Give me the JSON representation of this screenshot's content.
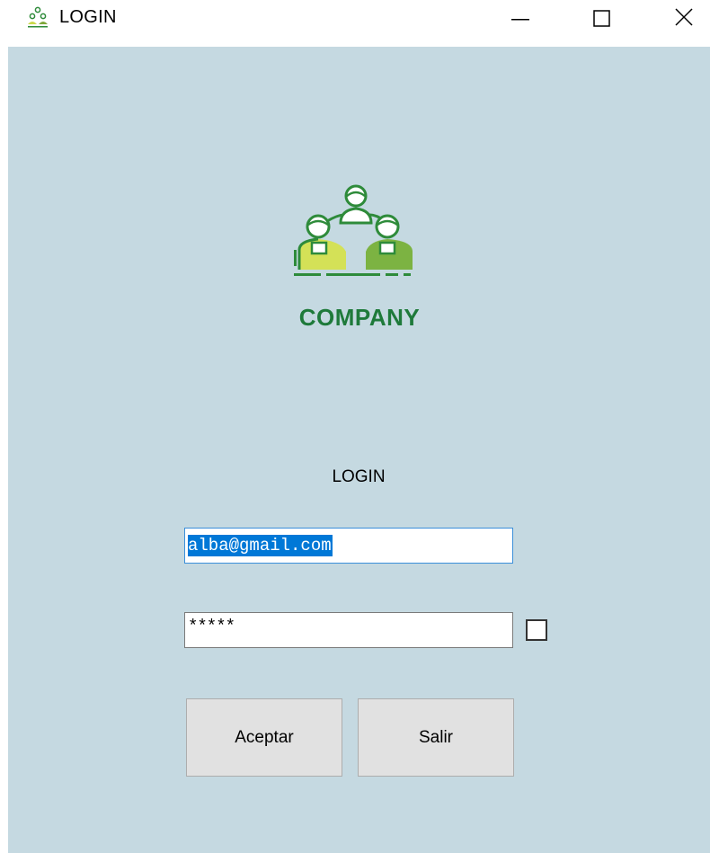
{
  "window": {
    "title": "LOGIN"
  },
  "brand": {
    "name": "COMPANY",
    "color": "#1e7a3a"
  },
  "form": {
    "heading": "LOGIN",
    "email_value": "alba@gmail.com",
    "password_value": "*****",
    "show_password_checked": false,
    "accept_label": "Aceptar",
    "exit_label": "Salir"
  },
  "colors": {
    "background": "#c5d9e1",
    "selection": "#0078d7",
    "button": "#e1e1e1"
  },
  "icons": {
    "app": "team-icon",
    "logo": "team-logo-icon",
    "minimize": "minimize-icon",
    "maximize": "maximize-icon",
    "close": "close-icon"
  }
}
